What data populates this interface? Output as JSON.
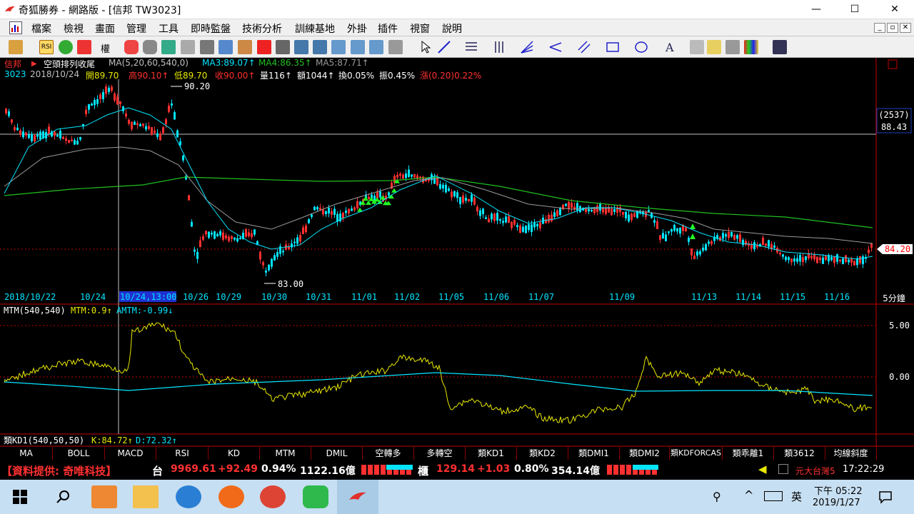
{
  "window": {
    "title": "奇狐勝券 - 網路版 - [信邦 TW3023]",
    "min": "—",
    "max": "☐",
    "close": "✕"
  },
  "menu": [
    "檔案",
    "檢視",
    "畫面",
    "管理",
    "工具",
    "即時監盤",
    "技術分析",
    "訓練基地",
    "外掛",
    "插件",
    "視窗",
    "說明"
  ],
  "toolbar": {
    "rsi_label": "RSI",
    "weight_label": "權"
  },
  "info": {
    "stock_name": "信邦",
    "strategy": "空頭排列收尾",
    "ma_params": "MA(5,20,60,540,0)",
    "ma3": "MA3:89.07↑",
    "ma4": "MA4:86.35↑",
    "ma5": "MA5:87.71↑",
    "code": "3023",
    "date": "2018/10/24",
    "open": "開89.70",
    "high": "高90.10↑",
    "low": "低89.70",
    "close": "收90.00↑",
    "volume": "量116↑",
    "amount": "額1044↑",
    "turnover": "換0.05%",
    "amplitude": "振0.45%",
    "change": "漲(0.20)0.22%"
  },
  "price_panel": {
    "crosshair_label": "(2537)",
    "crosshair_price": "88.43",
    "current_price": "84.20",
    "high_mark": "90.20",
    "low_mark": "83.00",
    "timeframe": "5分鐘",
    "dates": [
      "2018/10/22",
      "10/24",
      "10/24,13:00",
      "10/26",
      "10/29",
      "10/30",
      "10/31",
      "11/01",
      "11/02",
      "11/05",
      "11/06",
      "11/07",
      "11/09",
      "11/13",
      "11/14",
      "11/15",
      "11/16"
    ]
  },
  "mtm_panel": {
    "title": "MTM(540,540)",
    "mtm": "MTM:0.9↑",
    "amtm": "AMTM:-0.99↓",
    "scale_top": "5.00",
    "scale_mid": "0.00"
  },
  "kd_panel": {
    "title": "類KD1(540,50,50)",
    "k": "K:84.72↑",
    "d": "D:72.32↑"
  },
  "function_tabs": [
    "MA",
    "BOLL",
    "MACD",
    "RSI",
    "KD",
    "MTM",
    "DMIL",
    "空轉多",
    "多轉空",
    "類KD1",
    "類KD2",
    "類DMI1",
    "類DMI2",
    "類KDFORCAS",
    "類乖離1",
    "類3612",
    "均線斜度"
  ],
  "status": {
    "provider": "【資料提供: 奇唯科技】",
    "taiex_label": "台",
    "taiex_value": "9969.61",
    "taiex_change": "+92.49",
    "taiex_pct": "0.94%",
    "taiex_amount": "1122.16億",
    "otc_label": "櫃",
    "otc_value": "129.14",
    "otc_change": "+1.03",
    "otc_pct": "0.80%",
    "otc_amount": "354.14億",
    "broker": "元大台灣5",
    "clock": "17:22:29"
  },
  "taskbar": {
    "ime": "英",
    "time": "下午 05:22",
    "date": "2019/1/27"
  },
  "colors": {
    "up": "#ff3030",
    "down": "#00e5ff",
    "ma_long": "#20c020",
    "ma_mid": "#9a9a9a",
    "mtm_line": "#e8e800"
  }
}
